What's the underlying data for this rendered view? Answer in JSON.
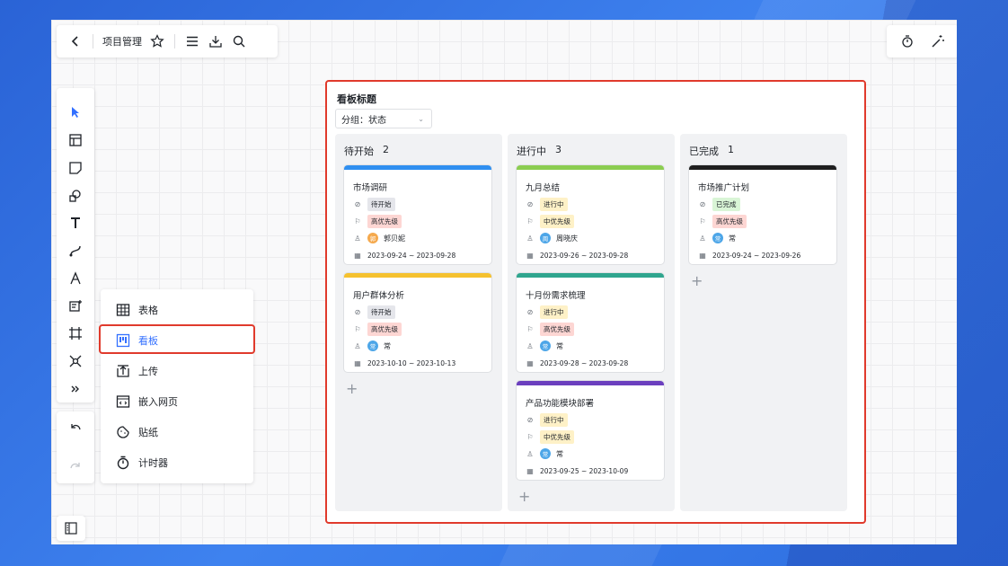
{
  "toolbar": {
    "doc_title": "项目管理",
    "back_icon": "chevron-left-icon",
    "star_icon": "star-icon",
    "menu_icon": "menu-icon",
    "download_icon": "download-icon",
    "search_icon": "search-icon"
  },
  "top_right": {
    "timer_icon": "stopwatch-icon",
    "magic_icon": "magic-wand-icon"
  },
  "menu": {
    "items": [
      {
        "label": "表格",
        "icon": "table-icon"
      },
      {
        "label": "看板",
        "icon": "kanban-icon"
      },
      {
        "label": "上传",
        "icon": "upload-icon"
      },
      {
        "label": "嵌入网页",
        "icon": "embed-icon"
      },
      {
        "label": "贴纸",
        "icon": "sticker-icon"
      },
      {
        "label": "计时器",
        "icon": "timer-icon"
      }
    ],
    "active_index": 1
  },
  "kanban": {
    "title": "看板标题",
    "group_by": "分组：状态",
    "columns": [
      {
        "name": "待开始",
        "count": "2",
        "cards": [
          {
            "title": "市场调研",
            "status": "待开始",
            "priority": "高优先级",
            "assignee_initial": "郭",
            "assignee": "郭贝妮",
            "date": "2023-09-24 ~ 2023-09-28",
            "bar_color": "#2f8ff0",
            "avatar_color": "#f5a94d"
          },
          {
            "title": "用户群体分析",
            "status": "待开始",
            "priority": "高优先级",
            "assignee_initial": "常",
            "assignee": "常",
            "date": "2023-10-10 ~ 2023-10-13",
            "bar_color": "#f5c12e",
            "avatar_color": "#4da6e8"
          }
        ]
      },
      {
        "name": "进行中",
        "count": "3",
        "cards": [
          {
            "title": "九月总结",
            "status": "进行中",
            "priority": "中优先级",
            "assignee_initial": "周",
            "assignee": "周晓庆",
            "date": "2023-09-26 ~ 2023-09-28",
            "bar_color": "#8bcd50",
            "avatar_color": "#4da6e8"
          },
          {
            "title": "十月份需求梳理",
            "status": "进行中",
            "priority": "高优先级",
            "assignee_initial": "常",
            "assignee": "常",
            "date": "2023-09-28 ~ 2023-09-28",
            "bar_color": "#2fa58e",
            "avatar_color": "#4da6e8"
          },
          {
            "title": "产品功能模块部署",
            "status": "进行中",
            "priority": "中优先级",
            "assignee_initial": "常",
            "assignee": "常",
            "date": "2023-09-25 ~ 2023-10-09",
            "bar_color": "#6b3fbe",
            "avatar_color": "#4da6e8"
          }
        ]
      },
      {
        "name": "已完成",
        "count": "1",
        "cards": [
          {
            "title": "市场推广计划",
            "status": "已完成",
            "priority": "高优先级",
            "assignee_initial": "常",
            "assignee": "常",
            "date": "2023-09-24 ~ 2023-09-26",
            "bar_color": "#1f1f1f",
            "avatar_color": "#4da6e8"
          }
        ]
      }
    ]
  },
  "colors": {
    "highlight": "#e03a2c",
    "accent": "#3370ff"
  }
}
